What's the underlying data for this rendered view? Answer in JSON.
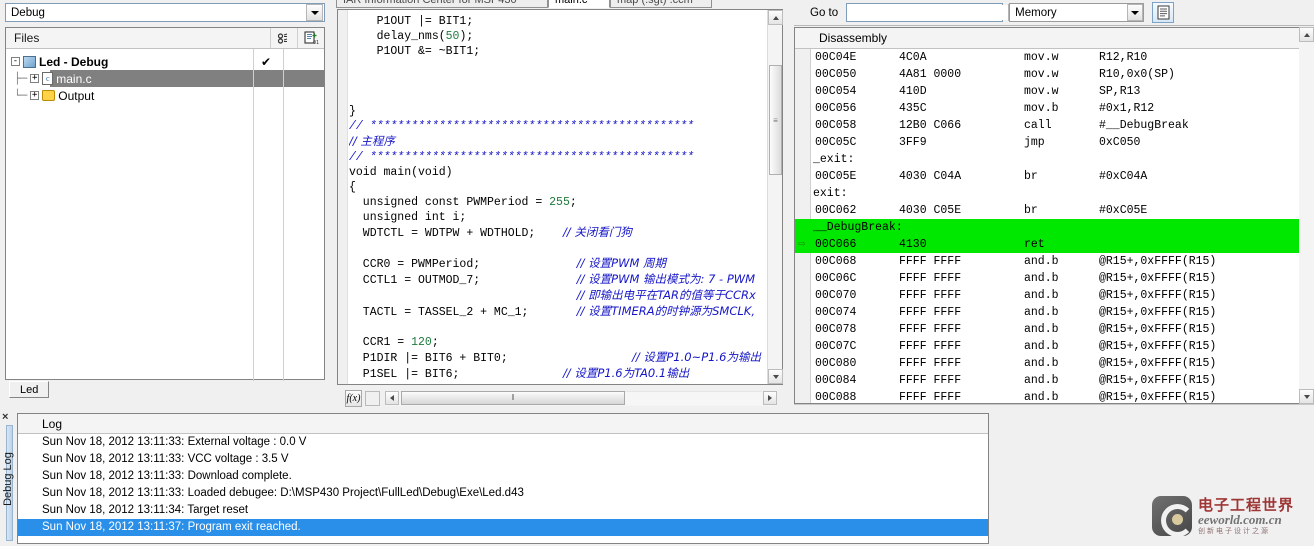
{
  "workspace": {
    "config_combo": {
      "value": "Debug",
      "icon": "chevron-down-icon"
    },
    "header": {
      "title": "Files",
      "icon_1": "make-icon",
      "icon_2": "compile-icon"
    },
    "tree": [
      {
        "label": "Led - Debug",
        "icon": "project-icon",
        "expander": "-",
        "check": "✔",
        "level": 0,
        "selected": false
      },
      {
        "label": "main.c",
        "icon": "c-file-icon",
        "expander": "+",
        "check": "",
        "level": 1,
        "selected": true
      },
      {
        "label": "Output",
        "icon": "folder-icon",
        "expander": "+",
        "check": "",
        "level": 1,
        "selected": false
      }
    ],
    "tab": {
      "label": "Led"
    }
  },
  "editor": {
    "tabs": [
      {
        "label": "IAR Information Center for MSP430",
        "active": false
      },
      {
        "label": "main.c",
        "active": true
      },
      {
        "label": "map (.sgt) .ccm",
        "active": false
      }
    ],
    "code_lines": [
      {
        "segments": [
          {
            "t": "    P1OUT |= BIT1;",
            "k": "plain"
          }
        ]
      },
      {
        "segments": [
          {
            "t": "    delay_nms(",
            "k": "plain"
          },
          {
            "t": "50",
            "k": "num"
          },
          {
            "t": ");",
            "k": "plain"
          }
        ]
      },
      {
        "segments": [
          {
            "t": "    P1OUT &= ~BIT1;",
            "k": "plain"
          }
        ]
      },
      {
        "segments": []
      },
      {
        "segments": []
      },
      {
        "segments": []
      },
      {
        "segments": [
          {
            "t": "}",
            "k": "plain"
          }
        ]
      },
      {
        "segments": [
          {
            "t": "// ***********************************************",
            "k": "cm"
          }
        ]
      },
      {
        "segments": [
          {
            "t": "// 主程序",
            "k": "cmcn"
          }
        ]
      },
      {
        "segments": [
          {
            "t": "// ***********************************************",
            "k": "cm"
          }
        ]
      },
      {
        "segments": [
          {
            "t": "void main(void)",
            "k": "plain"
          }
        ]
      },
      {
        "segments": [
          {
            "t": "{",
            "k": "plain"
          }
        ]
      },
      {
        "segments": [
          {
            "t": "  unsigned const PWMPeriod = ",
            "k": "plain"
          },
          {
            "t": "255",
            "k": "num"
          },
          {
            "t": ";",
            "k": "plain"
          }
        ]
      },
      {
        "segments": [
          {
            "t": "  unsigned int i;",
            "k": "plain"
          }
        ]
      },
      {
        "segments": [
          {
            "t": "  WDTCTL = WDTPW + WDTHOLD;    ",
            "k": "plain"
          },
          {
            "t": "// 关闭看门狗",
            "k": "cmcn"
          }
        ]
      },
      {
        "segments": []
      },
      {
        "segments": [
          {
            "t": "  CCR0 = PWMPeriod;              ",
            "k": "plain"
          },
          {
            "t": "// 设置PWM 周期",
            "k": "cmcn"
          }
        ]
      },
      {
        "segments": [
          {
            "t": "  CCTL1 = OUTMOD_7;              ",
            "k": "plain"
          },
          {
            "t": "// 设置PWM 输出模式为: 7 - PWM",
            "k": "cmcn"
          }
        ]
      },
      {
        "segments": [
          {
            "t": "                                 ",
            "k": "plain"
          },
          {
            "t": "// 即输出电平在TAR的值等于CCRx",
            "k": "cmcn"
          }
        ]
      },
      {
        "segments": [
          {
            "t": "  TACTL = TASSEL_2 + MC_1;       ",
            "k": "plain"
          },
          {
            "t": "// 设置TIMERA的时钟源为SMCLK,",
            "k": "cmcn"
          }
        ]
      },
      {
        "segments": []
      },
      {
        "segments": [
          {
            "t": "  CCR1 = ",
            "k": "plain"
          },
          {
            "t": "120",
            "k": "num"
          },
          {
            "t": ";",
            "k": "plain"
          }
        ]
      },
      {
        "segments": [
          {
            "t": "  P1DIR |= BIT6 + BIT0;                  ",
            "k": "plain"
          },
          {
            "t": "// 设置P1.0~P1.6为输出",
            "k": "cmcn"
          }
        ]
      },
      {
        "segments": [
          {
            "t": "  P1SEL |= BIT6;               ",
            "k": "plain"
          },
          {
            "t": "// 设置P1.6为TA0.1输出",
            "k": "cmcn"
          }
        ]
      }
    ],
    "fx_button": "f(x)",
    "scroll_grip": "‖"
  },
  "disassembly": {
    "toolbar": {
      "goto_label": "Go to",
      "goto_value": "",
      "goto_placeholder": "",
      "zone_value": "Memory",
      "page_icon": "document-icon"
    },
    "header": {
      "title": "Disassembly"
    },
    "rows": [
      {
        "type": "code",
        "addr": "00C04E",
        "hex": "4C0A",
        "mn": "mov.w",
        "op": "R12,R10",
        "hl": false,
        "pc": false
      },
      {
        "type": "code",
        "addr": "00C050",
        "hex": "4A81 0000",
        "mn": "mov.w",
        "op": "R10,0x0(SP)",
        "hl": false,
        "pc": false
      },
      {
        "type": "code",
        "addr": "00C054",
        "hex": "410D",
        "mn": "mov.w",
        "op": "SP,R13",
        "hl": false,
        "pc": false
      },
      {
        "type": "code",
        "addr": "00C056",
        "hex": "435C",
        "mn": "mov.b",
        "op": "#0x1,R12",
        "hl": false,
        "pc": false
      },
      {
        "type": "code",
        "addr": "00C058",
        "hex": "12B0 C066",
        "mn": "call",
        "op": "#__DebugBreak",
        "hl": false,
        "pc": false
      },
      {
        "type": "code",
        "addr": "00C05C",
        "hex": "3FF9",
        "mn": "jmp",
        "op": "0xC050",
        "hl": false,
        "pc": false
      },
      {
        "type": "label",
        "label": "_exit:",
        "hl": false,
        "pc": false
      },
      {
        "type": "code",
        "addr": "00C05E",
        "hex": "4030 C04A",
        "mn": "br",
        "op": "#0xC04A",
        "hl": false,
        "pc": false
      },
      {
        "type": "label",
        "label": "exit:",
        "hl": false,
        "pc": false
      },
      {
        "type": "code",
        "addr": "00C062",
        "hex": "4030 C05E",
        "mn": "br",
        "op": "#0xC05E",
        "hl": false,
        "pc": false
      },
      {
        "type": "label",
        "label": "__DebugBreak:",
        "hl": true,
        "pc": false
      },
      {
        "type": "code",
        "addr": "00C066",
        "hex": "4130",
        "mn": "ret",
        "op": "",
        "hl": true,
        "pc": true
      },
      {
        "type": "code",
        "addr": "00C068",
        "hex": "FFFF FFFF",
        "mn": "and.b",
        "op": "@R15+,0xFFFF(R15)",
        "hl": false,
        "pc": false
      },
      {
        "type": "code",
        "addr": "00C06C",
        "hex": "FFFF FFFF",
        "mn": "and.b",
        "op": "@R15+,0xFFFF(R15)",
        "hl": false,
        "pc": false
      },
      {
        "type": "code",
        "addr": "00C070",
        "hex": "FFFF FFFF",
        "mn": "and.b",
        "op": "@R15+,0xFFFF(R15)",
        "hl": false,
        "pc": false
      },
      {
        "type": "code",
        "addr": "00C074",
        "hex": "FFFF FFFF",
        "mn": "and.b",
        "op": "@R15+,0xFFFF(R15)",
        "hl": false,
        "pc": false
      },
      {
        "type": "code",
        "addr": "00C078",
        "hex": "FFFF FFFF",
        "mn": "and.b",
        "op": "@R15+,0xFFFF(R15)",
        "hl": false,
        "pc": false
      },
      {
        "type": "code",
        "addr": "00C07C",
        "hex": "FFFF FFFF",
        "mn": "and.b",
        "op": "@R15+,0xFFFF(R15)",
        "hl": false,
        "pc": false
      },
      {
        "type": "code",
        "addr": "00C080",
        "hex": "FFFF FFFF",
        "mn": "and.b",
        "op": "@R15+,0xFFFF(R15)",
        "hl": false,
        "pc": false
      },
      {
        "type": "code",
        "addr": "00C084",
        "hex": "FFFF FFFF",
        "mn": "and.b",
        "op": "@R15+,0xFFFF(R15)",
        "hl": false,
        "pc": false
      },
      {
        "type": "code",
        "addr": "00C088",
        "hex": "FFFF FFFF",
        "mn": "and.b",
        "op": "@R15+,0xFFFF(R15)",
        "hl": false,
        "pc": false
      }
    ],
    "pc_marker": "⇨"
  },
  "debug_log": {
    "panel_title": "Debug Log",
    "close_icon": "close-icon",
    "header": {
      "title": "Log"
    },
    "entries": [
      {
        "text": "Sun Nov 18, 2012 13:11:33: External voltage : 0.0 V",
        "selected": false
      },
      {
        "text": "Sun Nov 18, 2012 13:11:33: VCC voltage : 3.5 V",
        "selected": false
      },
      {
        "text": "Sun Nov 18, 2012 13:11:33: Download complete.",
        "selected": false
      },
      {
        "text": "Sun Nov 18, 2012 13:11:33: Loaded debugee: D:\\MSP430 Project\\FullLed\\Debug\\Exe\\Led.d43",
        "selected": false
      },
      {
        "text": "Sun Nov 18, 2012 13:11:34: Target reset",
        "selected": false
      },
      {
        "text": "Sun Nov 18, 2012 13:11:37: Program exit reached.",
        "selected": true
      }
    ]
  },
  "watermark": {
    "cn": "电子工程世界",
    "en": "eeworld.com.cn",
    "sub": "创新电子设计之源"
  },
  "colors": {
    "highlight_green": "#00e800",
    "selection_blue": "#2a8fe8",
    "tree_selection_gray": "#808080",
    "comment_blue": "#1616c8",
    "number_green": "#1f7a3d"
  }
}
